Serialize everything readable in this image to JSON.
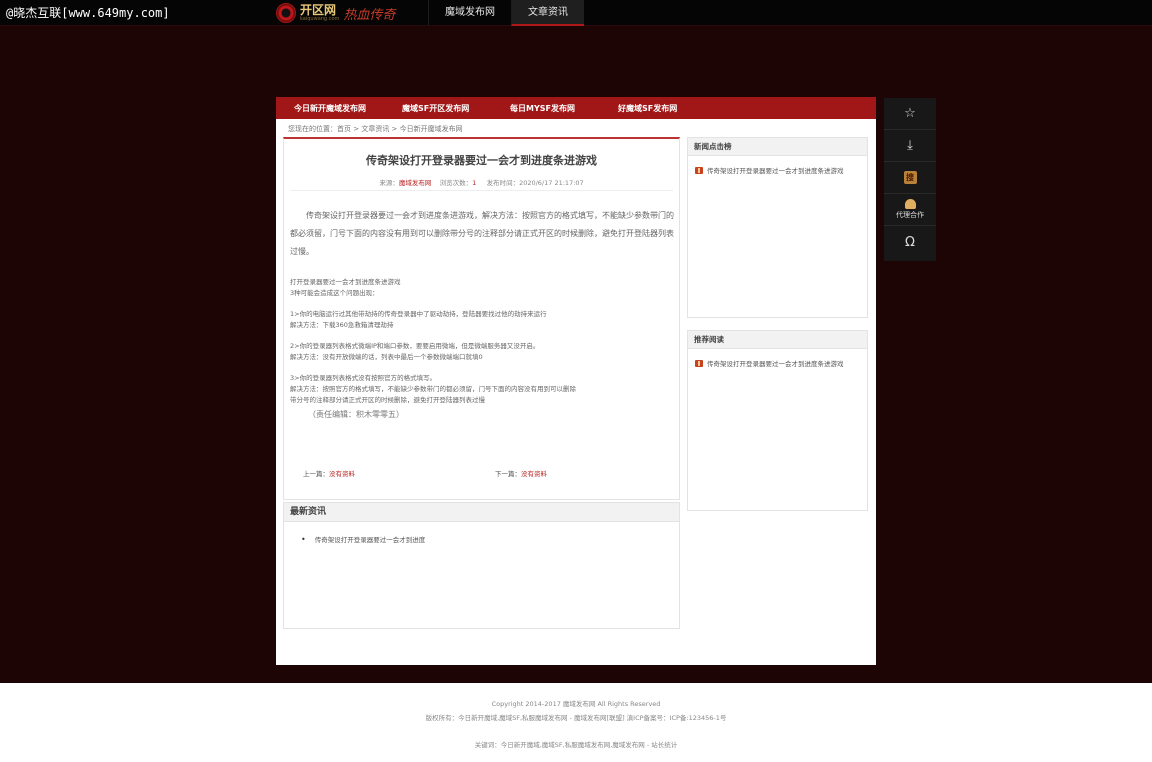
{
  "watermark": "@晓杰互联[www.649my.com]",
  "logo": {
    "name": "开区网",
    "sub": "kaiquwang.com",
    "script": "热血传奇"
  },
  "topnav": [
    "魔域发布网",
    "文章资讯"
  ],
  "rednav": [
    "今日新开魔域发布网",
    "魔域SF开区发布网",
    "每日MYSF发布网",
    "好魔域SF发布网"
  ],
  "breadcrumb": {
    "prefix": "您现在的位置：",
    "home": "首页",
    "sep": " > ",
    "section": "文章资讯",
    "current": "今日新开魔域发布网"
  },
  "article": {
    "title": "传奇架设打开登录器要过一会才到进度条进游戏",
    "meta_source_label": "来源：",
    "meta_source": "魔域发布网",
    "meta_views_label": "浏览次数：",
    "meta_views": "1",
    "meta_time_label": "发布时间：",
    "meta_time": "2020/6/17 21:17:07",
    "lead": "传奇架设打开登录器要过一会才到进度条进游戏，解决方法：按照官方的格式填写，不能缺少参数带门的都必须留，门号下面的内容没有用到可以删除带分号的注释部分请正式开区的时候删除，避免打开登陆器列表过慢。",
    "lines": [
      "打开登录器要过一会才到进度条进游戏",
      "3种可能会造成这个问题出现：",
      "",
      "1>你的电脑运行过其他带劫持的传奇登录器中了驱动劫持，登陆器要找过他的劫持来运行",
      "解决方法：下载360急救箱清理劫持",
      "",
      "2>你的登录器列表格式微端IP和端口参数，要要启用微端，但是微端服务器又没开启。",
      "解决方法：没有开放微端的话，列表中最后一个参数微端端口就填0",
      "",
      "3>你的登录器列表格式没有按照官方的格式填写。",
      "解决方法：按照官方的格式填写，不能缺少参数带门的都必须留，门号下面的内容没有用到可以删除",
      "带分号的注释部分请正式开区的时候删除，避免打开登陆器列表过慢"
    ],
    "editor": "（责任编辑：积木零零五）",
    "prev_label": "上一篇：",
    "prev_value": "没有资料",
    "next_label": "下一篇：",
    "next_value": "没有资料"
  },
  "latest": {
    "heading": "最新资讯",
    "items": [
      "传奇架设打开登录器要过一会才到进度"
    ]
  },
  "sidebar": {
    "hot_heading": "新闻点击榜",
    "hot_items": [
      "传奇架设打开登录器要过一会才到进度条进游戏"
    ],
    "rec_heading": "推荐阅读",
    "rec_items": [
      "传奇架设打开登录器要过一会才到进度条进游戏"
    ]
  },
  "floatbar": {
    "star_icon": "☆",
    "download_icon": "⤓",
    "search_glyph": "搜",
    "agent_label": "代理合作",
    "omega_icon": "Ω"
  },
  "footer": {
    "copyright": "Copyright 2014-2017  魔域发布网  All Rights Reserved",
    "rights": "版权所有：今日新开魔域,魔域SF,私服魔域发布网 - 魔域发布网[联盟]   滇ICP备案号：ICP备:123456-1号",
    "keywords": "关键词：今日新开魔域,魔域SF,私服魔域发布网,魔域发布网 - 站长统计"
  }
}
